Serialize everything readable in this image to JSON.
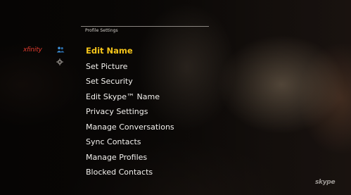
{
  "header": {
    "section_title": "Profile Settings"
  },
  "brand": {
    "name": "xfinity",
    "color": "#e23b2e"
  },
  "skype_logo": "skype",
  "side_icons": [
    {
      "name": "contacts-icon"
    },
    {
      "name": "settings-icon"
    }
  ],
  "menu": {
    "selected_index": 0,
    "selected_color": "#f6c51a",
    "items": [
      {
        "label": "Edit Name"
      },
      {
        "label": "Set Picture"
      },
      {
        "label": "Set Security"
      },
      {
        "label": "Edit Skype™ Name"
      },
      {
        "label": "Privacy Settings"
      },
      {
        "label": "Manage Conversations"
      },
      {
        "label": "Sync Contacts"
      },
      {
        "label": "Manage Profiles"
      },
      {
        "label": "Blocked Contacts"
      }
    ]
  }
}
